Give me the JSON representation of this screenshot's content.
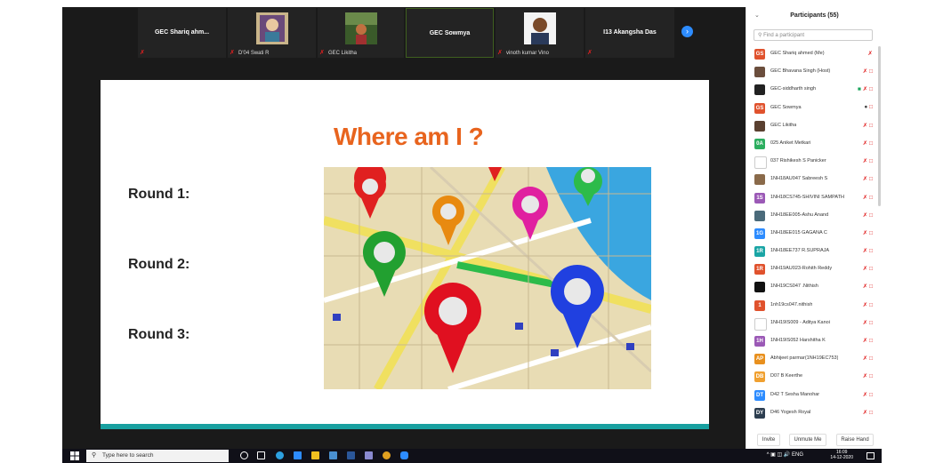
{
  "video_strip": {
    "tiles": [
      {
        "name": "GEC Shariq ahm...",
        "label": ""
      },
      {
        "name": "",
        "label": "D'04 Swati R"
      },
      {
        "name": "",
        "label": "GEC Likitha"
      },
      {
        "name": "GEC Sowmya",
        "label": ""
      },
      {
        "name": "",
        "label": "vinoth kumar Vino"
      },
      {
        "name": "I13 Akangsha Das",
        "label": ""
      }
    ],
    "next_icon": "chevron-right-icon"
  },
  "slide": {
    "title": "Where am I ?",
    "rounds": [
      "Round 1:",
      "Round 2:",
      "Round 3:"
    ]
  },
  "participants": {
    "title": "Participants (55)",
    "search_placeholder": "Find a participant",
    "list": [
      {
        "initials": "GS",
        "color": "#e0522d",
        "name": "GEC Shariq ahmed (Me)",
        "video": false,
        "muted": true,
        "cam_off": false
      },
      {
        "initials": "",
        "color": "#6b4e3d",
        "name": "GEC Bhavana Singh (Host)",
        "video": false,
        "muted": true,
        "cam_off": true
      },
      {
        "initials": "",
        "color": "#222222",
        "name": "GEC-siddharth singh",
        "video": true,
        "muted": true,
        "cam_off": true
      },
      {
        "initials": "GS",
        "color": "#e0522d",
        "name": "GEC Sowmya",
        "video": false,
        "muted": false,
        "cam_off": true
      },
      {
        "initials": "",
        "color": "#5a4030",
        "name": "GEC Likitha",
        "video": false,
        "muted": true,
        "cam_off": true
      },
      {
        "initials": "0A",
        "color": "#2cae5f",
        "name": "025 Aniket Metkari",
        "video": false,
        "muted": true,
        "cam_off": true
      },
      {
        "initials": "",
        "color": "#ffffff",
        "name": "037 Rishikesh S Panicker",
        "video": false,
        "muted": true,
        "cam_off": true
      },
      {
        "initials": "",
        "color": "#8a6a4a",
        "name": "1NH18AU047 Sabreesh S",
        "video": false,
        "muted": true,
        "cam_off": true
      },
      {
        "initials": "1S",
        "color": "#9b59b6",
        "name": "1NH18CS745-SHIVINI SAMPATH",
        "video": false,
        "muted": true,
        "cam_off": true
      },
      {
        "initials": "",
        "color": "#4a6a7a",
        "name": "1NH18EE005-Ashu Anand",
        "video": false,
        "muted": true,
        "cam_off": true
      },
      {
        "initials": "1G",
        "color": "#2d8cff",
        "name": "1NH18EE015 GAGANA C",
        "video": false,
        "muted": true,
        "cam_off": true
      },
      {
        "initials": "1R",
        "color": "#1aa5a5",
        "name": "1NH18EE737 R.SUPRAJA",
        "video": false,
        "muted": true,
        "cam_off": true
      },
      {
        "initials": "1R",
        "color": "#e0522d",
        "name": "1NH19AU023-Rohith Reddy",
        "video": false,
        "muted": true,
        "cam_off": true
      },
      {
        "initials": "",
        "color": "#111111",
        "name": "1NH19CS047 .Nithish",
        "video": false,
        "muted": true,
        "cam_off": true
      },
      {
        "initials": "1",
        "color": "#e0522d",
        "name": "1nh19cs047.nithish",
        "video": false,
        "muted": true,
        "cam_off": true
      },
      {
        "initials": "",
        "color": "#ffffff",
        "name": "1NH19IS009 - Aditya Kanoi",
        "video": false,
        "muted": true,
        "cam_off": true
      },
      {
        "initials": "1H",
        "color": "#9b59b6",
        "name": "1NH19IS052 Harshitha K",
        "video": false,
        "muted": true,
        "cam_off": true
      },
      {
        "initials": "AP",
        "color": "#e8901e",
        "name": "Abhijeet parmar(1NH19EC753)",
        "video": false,
        "muted": true,
        "cam_off": true
      },
      {
        "initials": "DB",
        "color": "#f0a030",
        "name": "D07 B Keerthe",
        "video": false,
        "muted": true,
        "cam_off": true
      },
      {
        "initials": "DT",
        "color": "#2d8cff",
        "name": "D42 T Sesha Manohar",
        "video": false,
        "muted": true,
        "cam_off": true
      },
      {
        "initials": "DY",
        "color": "#2d3e50",
        "name": "D46 Yogesh Royal",
        "video": false,
        "muted": true,
        "cam_off": true
      }
    ],
    "footer": {
      "invite": "Invite",
      "unmute": "Unmute Me",
      "raise": "Raise Hand"
    }
  },
  "taskbar": {
    "search_text": "Type here to search",
    "tray_lang": "ENG",
    "time": "16:09",
    "date": "14-12-2020"
  }
}
